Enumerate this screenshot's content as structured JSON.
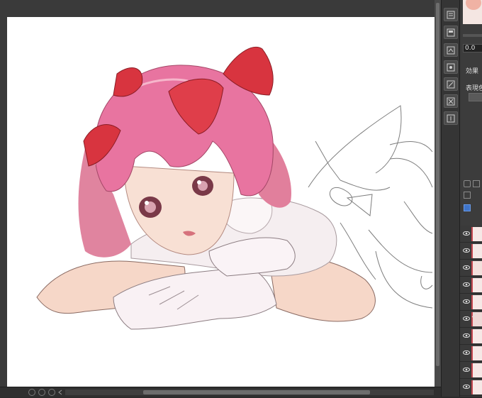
{
  "panel": {
    "value_field": "0.0",
    "effect_label": "効果",
    "expression_color_label": "表現色"
  },
  "layers": [
    {
      "visible": true,
      "thumb_color": "#f6e8e6"
    },
    {
      "visible": true,
      "thumb_color": "#f6e8e6"
    },
    {
      "visible": true,
      "thumb_color": "#f3e0dc"
    },
    {
      "visible": true,
      "thumb_color": "#f6e8e6"
    },
    {
      "visible": true,
      "thumb_color": "#f6e8e6"
    },
    {
      "visible": true,
      "thumb_color": "#efd8d6"
    },
    {
      "visible": true,
      "thumb_color": "#f6e8e6"
    },
    {
      "visible": true,
      "thumb_color": "#f6e8e6"
    },
    {
      "visible": true,
      "thumb_color": "#f6e8e6"
    },
    {
      "visible": true,
      "thumb_color": "#f6e8e6"
    }
  ],
  "tool_icons": [
    "layer-property-icon",
    "copy-icon",
    "paste-icon",
    "transform-icon",
    "layer-settings-icon",
    "edit-icon",
    "delete-icon",
    "info-icon"
  ],
  "colors": {
    "hair": "#e8799a",
    "ribbon": "#d8343f",
    "skin": "#f7dccd",
    "accent_red": "#c4474f"
  }
}
